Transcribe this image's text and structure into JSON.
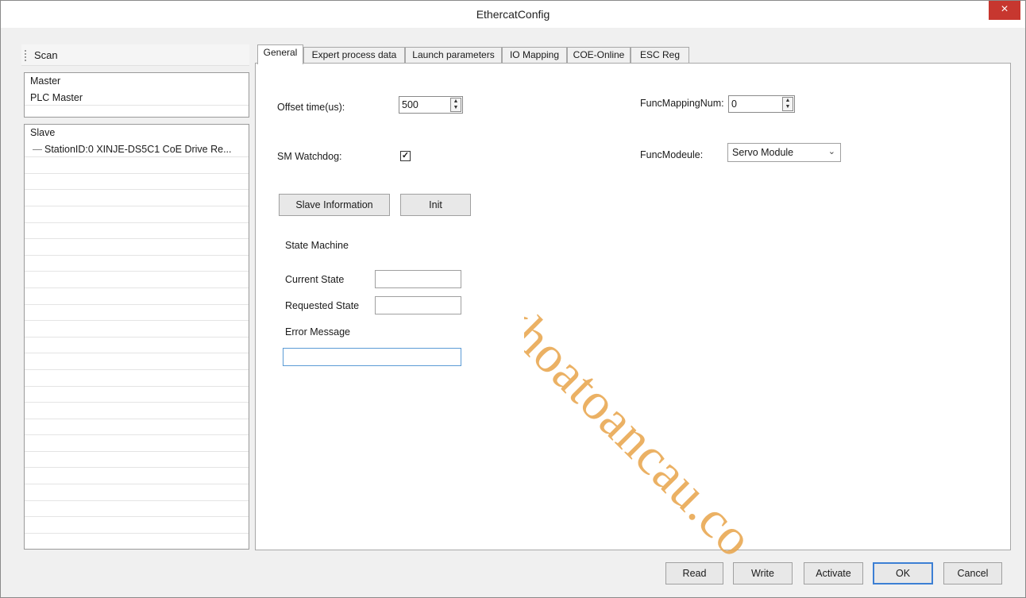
{
  "window": {
    "title": "EthercatConfig",
    "close": "×"
  },
  "left": {
    "scan": "Scan",
    "master_header": "Master",
    "master_items": [
      "PLC Master"
    ],
    "slave_header": "Slave",
    "slave_items": [
      "StationID:0 XINJE-DS5C1 CoE Drive Re..."
    ]
  },
  "tabs": [
    "General",
    "Expert process data",
    "Launch parameters",
    "IO Mapping",
    "COE-Online",
    "ESC Reg"
  ],
  "active_tab": "General",
  "general": {
    "offset_label": "Offset time(us):",
    "offset_value": "500",
    "watchdog_label": "SM Watchdog:",
    "watchdog_checked": true,
    "func_mapping_label": "FuncMappingNum:",
    "func_mapping_value": "0",
    "func_module_label": "FuncModeule:",
    "func_module_value": "Servo Module",
    "slave_info_button": "Slave Information",
    "init_button": "Init",
    "state_machine_label": "State Machine",
    "current_state_label": "Current State",
    "current_state_value": "",
    "requested_state_label": "Requested State",
    "requested_state_value": "",
    "error_message_label": "Error Message",
    "error_message_value": ""
  },
  "footer": {
    "read": "Read",
    "write": "Write",
    "activate": "Activate",
    "ok": "OK",
    "cancel": "Cancel"
  },
  "watermark": "tonghoatoancau.co",
  "colors": {
    "close_button": "#c7372f",
    "default_button_border": "#3c7fd4",
    "focus_border": "#5b9bd5",
    "watermark": "#e8a44a"
  }
}
